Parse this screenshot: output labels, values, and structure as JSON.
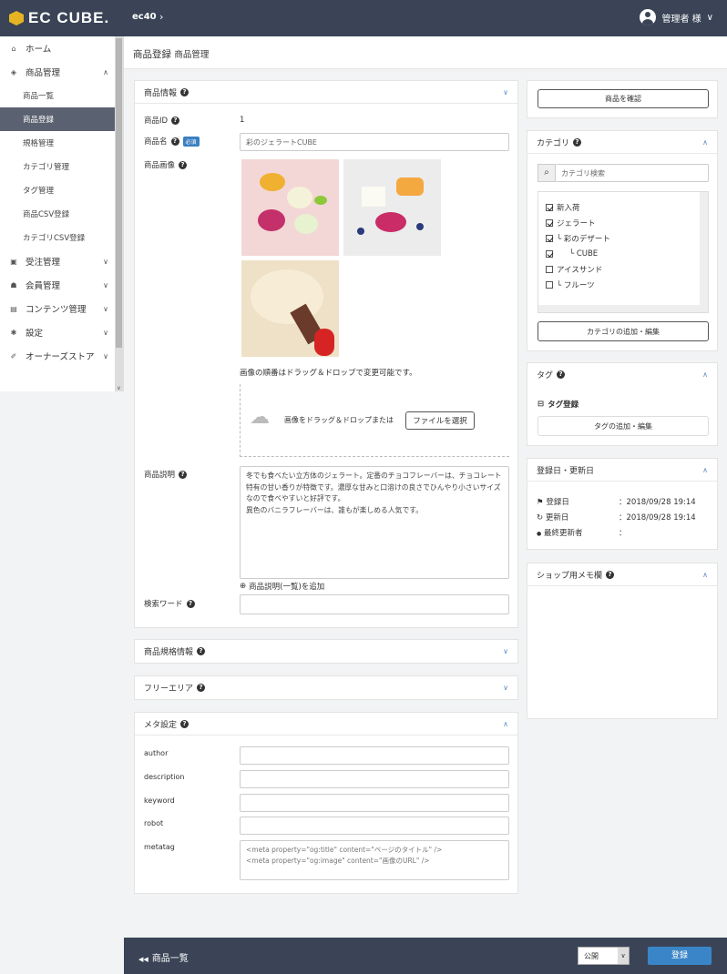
{
  "header": {
    "logo_text": "EC CUBE.",
    "shop": "ec40",
    "shop_chevron": "›",
    "user": "管理者 様",
    "user_chevron": "∨"
  },
  "sidebar": {
    "items": [
      {
        "label": "ホーム",
        "icon": "home-icon",
        "glyph": "⌂"
      },
      {
        "label": "商品管理",
        "icon": "cube-icon",
        "glyph": "◈",
        "chevron": "∧"
      },
      {
        "label": "受注管理",
        "icon": "cart-icon",
        "glyph": "▣",
        "chevron": "∨"
      },
      {
        "label": "会員管理",
        "icon": "users-icon",
        "glyph": "☗",
        "chevron": "∨"
      },
      {
        "label": "コンテンツ管理",
        "icon": "file-icon",
        "glyph": "▤",
        "chevron": "∨"
      },
      {
        "label": "設定",
        "icon": "gear-icon",
        "glyph": "✱",
        "chevron": "∨"
      },
      {
        "label": "オーナーズストア",
        "icon": "plug-icon",
        "glyph": "✐",
        "chevron": "∨"
      }
    ],
    "sub_items": [
      "商品一覧",
      "商品登録",
      "規格管理",
      "カテゴリ管理",
      "タグ管理",
      "商品CSV登録",
      "カテゴリCSV登録"
    ],
    "scroll_arrow": "∨"
  },
  "page": {
    "title": "商品登録",
    "title_sub": "商品管理"
  },
  "product_info": {
    "title": "商品情報",
    "id_label": "商品ID",
    "id_value": "1",
    "name_label": "商品名",
    "required": "必須",
    "name_value": "彩のジェラートCUBE",
    "image_label": "商品画像",
    "drag_note": "画像の順番はドラッグ＆ドロップで変更可能です。",
    "drop_text": "画像をドラッグ＆ドロップまたは",
    "file_button": "ファイルを選択",
    "desc_label": "商品説明",
    "desc_text": "冬でも食べたい立方体のジェラート。定番のチョコフレーバーは、チョコレート特有の甘い香りが特徴です。濃厚な甘みと口溶けの良さでひんやり小さいサイズなので食べやすいと好評です。\n異色のバニラフレーバーは、誰もが楽しめる人気です。",
    "add_desc": "商品説明(一覧)を追加",
    "search_label": "検索ワード"
  },
  "spec": {
    "title": "商品規格情報"
  },
  "free": {
    "title": "フリーエリア"
  },
  "meta": {
    "title": "メタ設定",
    "fields": [
      "author",
      "description",
      "keyword",
      "robot",
      "metatag"
    ],
    "metatag_value": "<meta property=\"og:title\" content=\"ページのタイトル\" />\n<meta property=\"og:image\" content=\"画像のURL\" />"
  },
  "right": {
    "preview_button": "商品を確認",
    "category_title": "カテゴリ",
    "category_search": "カテゴリ検索",
    "categories": [
      {
        "label": "新入荷",
        "checked": true
      },
      {
        "label": "ジェラート",
        "checked": true
      },
      {
        "label": "└ 彩のデザート",
        "checked": true
      },
      {
        "label": "└ CUBE",
        "checked": true
      },
      {
        "label": "アイスサンド",
        "checked": false
      },
      {
        "label": "└ フルーツ",
        "checked": false
      }
    ],
    "category_button": "カテゴリの追加・編集",
    "tag_title": "タグ",
    "tag_sub": "タグ登録",
    "tag_button": "タグの追加・編集",
    "date_title": "登録日・更新日",
    "created_label": "登録日",
    "created_value": "：2018/09/28 19:14",
    "updated_label": "更新日",
    "updated_value": "：2018/09/28 19:14",
    "editor_label": "最終更新者",
    "editor_value": "：",
    "memo_title": "ショップ用メモ欄"
  },
  "bottom": {
    "back": "商品一覧",
    "status": "公開",
    "save": "登録"
  },
  "glyphs": {
    "chevron_down": "∨",
    "chevron_up": "∧",
    "q": "?",
    "plus": "⊕",
    "search": "⌕",
    "back_arrows": "◀◀",
    "cloud": "☁",
    "flag": "⚑",
    "refresh": "↻",
    "user": "●",
    "tag": "⊟",
    "status_arrow": "∨"
  },
  "colors": {
    "header": "#3a4456",
    "accent": "#3a85c8",
    "active_nav": "#5a6170"
  }
}
